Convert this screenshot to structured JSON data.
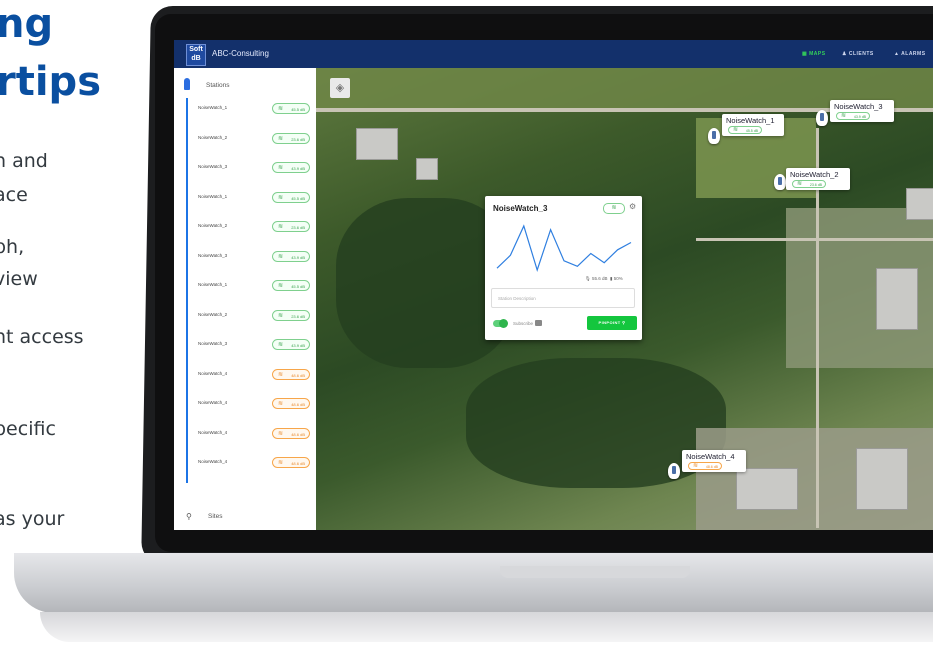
{
  "marketing": {
    "heading_line1": "ng",
    "heading_line2": "rtips",
    "lines": [
      "h and",
      "ace",
      "ph,",
      "view",
      "nt access",
      "pecific",
      "as your"
    ]
  },
  "app": {
    "logo_top": "Soft",
    "logo_bottom": "dB",
    "name": "ABC-Consulting",
    "nav": [
      "MAPS",
      "CLIENTS",
      "ALARMS"
    ],
    "nav_active": "MAPS",
    "colors": {
      "topbar": "#13306b",
      "accent_green": "#14c63e",
      "accent_orange": "#f7a64a",
      "accent_blue": "#1c74e6"
    }
  },
  "sidebar": {
    "stations_label": "Stations",
    "sites_label": "Sites",
    "stations": [
      {
        "name": "NoiseWatch_1",
        "level": "45.5 dB",
        "status": "green"
      },
      {
        "name": "NoiseWatch_2",
        "level": "23.6 dB",
        "status": "green"
      },
      {
        "name": "NoiseWatch_3",
        "level": "43.9 dB",
        "status": "green"
      },
      {
        "name": "NoiseWatch_1",
        "level": "45.5 dB",
        "status": "green"
      },
      {
        "name": "NoiseWatch_2",
        "level": "23.6 dB",
        "status": "green"
      },
      {
        "name": "NoiseWatch_3",
        "level": "43.9 dB",
        "status": "green"
      },
      {
        "name": "NoiseWatch_1",
        "level": "45.5 dB",
        "status": "green"
      },
      {
        "name": "NoiseWatch_2",
        "level": "23.6 dB",
        "status": "green"
      },
      {
        "name": "NoiseWatch_3",
        "level": "43.9 dB",
        "status": "green"
      },
      {
        "name": "NoiseWatch_4",
        "level": "48.6 dB",
        "status": "orange"
      },
      {
        "name": "NoiseWatch_4",
        "level": "48.6 dB",
        "status": "orange"
      },
      {
        "name": "NoiseWatch_4",
        "level": "48.6 dB",
        "status": "orange"
      },
      {
        "name": "NoiseWatch_4",
        "level": "48.6 dB",
        "status": "orange"
      }
    ]
  },
  "map_tags": [
    {
      "name": "NoiseWatch_3",
      "level": "43.9 dB",
      "status": "green"
    },
    {
      "name": "NoiseWatch_1",
      "level": "45.5 dB",
      "status": "green"
    },
    {
      "name": "NoiseWatch_2",
      "level": "23.6 dB",
      "status": "green"
    },
    {
      "name": "NoiseWatch_4",
      "level": "48.6 dB",
      "status": "orange"
    }
  ],
  "popup": {
    "title": "NoiseWatch_3",
    "level": "55.6 dB",
    "battery": "50%",
    "description_placeholder": "Station Description",
    "subscribe_label": "Subscribe",
    "subscribed": true,
    "pinpoint_label": "PINPOINT",
    "chart_series": [
      45,
      52,
      68,
      44,
      66,
      49,
      46,
      53,
      48,
      55,
      59
    ]
  }
}
